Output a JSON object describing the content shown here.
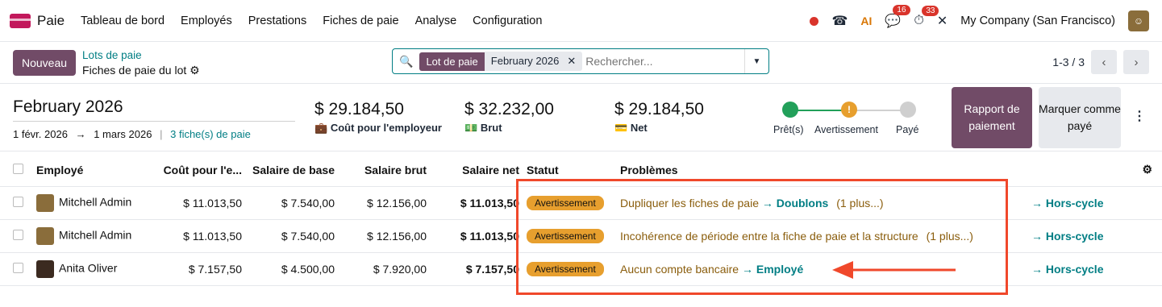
{
  "nav": {
    "app": "Paie",
    "menus": [
      "Tableau de bord",
      "Employés",
      "Prestations",
      "Fiches de paie",
      "Analyse",
      "Configuration"
    ],
    "chat_count": "16",
    "activity_count": "33",
    "company": "My Company (San Francisco)"
  },
  "control": {
    "new_label": "Nouveau",
    "breadcrumb_parent": "Lots de paie",
    "breadcrumb_current": "Fiches de paie du lot",
    "facet_label": "Lot de paie",
    "facet_value": "February 2026",
    "search_placeholder": "Rechercher...",
    "pager": "1-3 / 3"
  },
  "summary": {
    "title": "February 2026",
    "date_from": "1 févr. 2026",
    "arrow": "→",
    "date_to": "1 mars 2026",
    "sep": "|",
    "count_link": "3 fiche(s) de paie",
    "employer_cost": "$ 29.184,50",
    "employer_cost_label": "Coût pour l'employeur",
    "gross": "$ 32.232,00",
    "gross_label": "Brut",
    "net": "$ 29.184,50",
    "net_label": "Net",
    "steps": [
      "Prêt(s)",
      "Avertissement",
      "Payé"
    ],
    "report_button": "Rapport de paiement",
    "mark_button": "Marquer comme payé"
  },
  "table": {
    "headers": [
      "Employé",
      "Coût pour l'e...",
      "Salaire de base",
      "Salaire brut",
      "Salaire net",
      "Statut",
      "Problèmes"
    ],
    "rows": [
      {
        "employee": "Mitchell Admin",
        "cost": "$ 11.013,50",
        "base": "$ 7.540,00",
        "gross": "$ 12.156,00",
        "net": "$ 11.013,50",
        "status": "Avertissement",
        "problem": "Dupliquer les fiches de paie",
        "action": "→ Doublons",
        "more": "(1 plus...)",
        "offcycle": "→ Hors-cycle"
      },
      {
        "employee": "Mitchell Admin",
        "cost": "$ 11.013,50",
        "base": "$ 7.540,00",
        "gross": "$ 12.156,00",
        "net": "$ 11.013,50",
        "status": "Avertissement",
        "problem": "Incohérence de période entre la fiche de paie et la structure",
        "action": "",
        "more": "(1 plus...)",
        "offcycle": "→ Hors-cycle"
      },
      {
        "employee": "Anita Oliver",
        "cost": "$ 7.157,50",
        "base": "$ 4.500,00",
        "gross": "$ 7.920,00",
        "net": "$ 7.157,50",
        "status": "Avertissement",
        "problem": "Aucun compte bancaire",
        "action": "→ Employé",
        "more": "",
        "offcycle": "→ Hors-cycle"
      }
    ]
  },
  "colors": {
    "primary": "#714b67",
    "link": "#017e84",
    "warning": "#e79f2e",
    "highlight": "#f0482b"
  }
}
